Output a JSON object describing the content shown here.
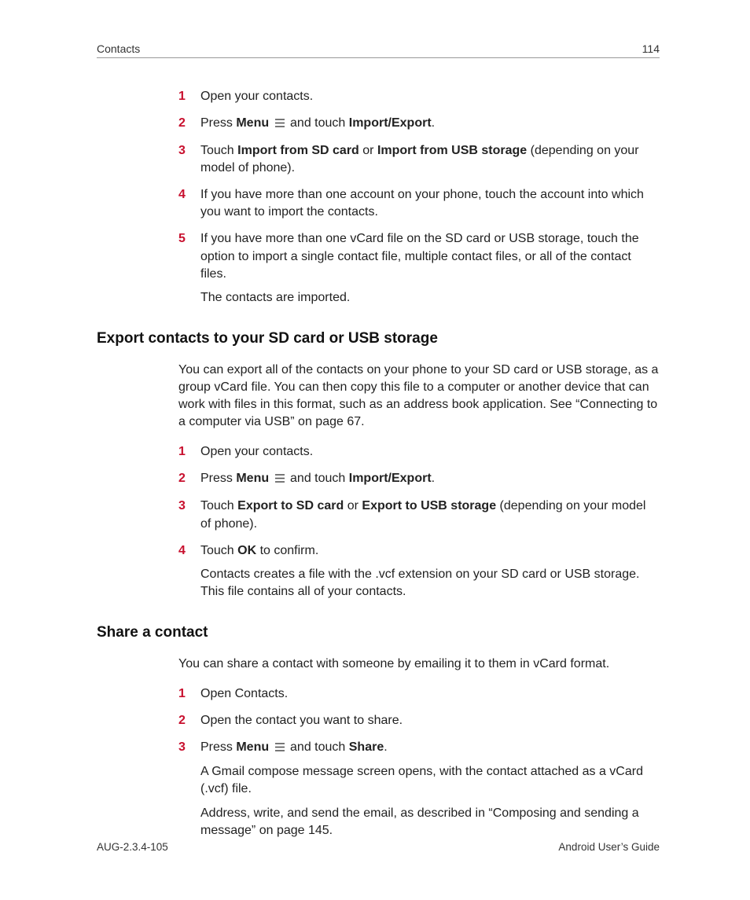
{
  "header": {
    "section": "Contacts",
    "page_number": "114"
  },
  "menu_label": "Menu",
  "import_section": {
    "steps": [
      {
        "n": "1",
        "body": [
          {
            "t": "Open your contacts."
          }
        ]
      },
      {
        "n": "2",
        "body": [
          {
            "t": "Press "
          },
          {
            "b": true,
            "t": "Menu"
          },
          {
            "t": " "
          },
          {
            "icon": true
          },
          {
            "t": " and touch "
          },
          {
            "b": true,
            "t": "Import/Export"
          },
          {
            "t": "."
          }
        ]
      },
      {
        "n": "3",
        "body": [
          {
            "t": "Touch "
          },
          {
            "b": true,
            "t": "Import from SD card"
          },
          {
            "t": " or "
          },
          {
            "b": true,
            "t": "Import from USB storage"
          },
          {
            "t": " (depending on your model of phone)."
          }
        ]
      },
      {
        "n": "4",
        "body": [
          {
            "t": "If you have more than one account on your phone, touch the account into which you want to import the contacts."
          }
        ]
      },
      {
        "n": "5",
        "body": [
          {
            "t": "If you have more than one vCard file on the SD card or USB storage, touch the option to import a single contact file, multiple contact files, or all of the contact files."
          }
        ],
        "extra": [
          {
            "t": "The contacts are imported."
          }
        ]
      }
    ]
  },
  "export_section": {
    "title": "Export contacts to your SD card or USB storage",
    "intro": "You can export all of the contacts on your phone to your SD card or USB storage, as a group vCard file. You can then copy this file to a computer or another device that can work with files in this format, such as an address book application. See “Connecting to a computer via USB” on page 67.",
    "steps": [
      {
        "n": "1",
        "body": [
          {
            "t": "Open your contacts."
          }
        ]
      },
      {
        "n": "2",
        "body": [
          {
            "t": "Press "
          },
          {
            "b": true,
            "t": "Menu"
          },
          {
            "t": " "
          },
          {
            "icon": true
          },
          {
            "t": " and touch "
          },
          {
            "b": true,
            "t": "Import/Export"
          },
          {
            "t": "."
          }
        ]
      },
      {
        "n": "3",
        "body": [
          {
            "t": "Touch "
          },
          {
            "b": true,
            "t": "Export to SD card"
          },
          {
            "t": " or "
          },
          {
            "b": true,
            "t": "Export to USB storage"
          },
          {
            "t": " (depending on your model of phone)."
          }
        ]
      },
      {
        "n": "4",
        "body": [
          {
            "t": "Touch "
          },
          {
            "b": true,
            "t": "OK"
          },
          {
            "t": " to confirm."
          }
        ],
        "extra": [
          {
            "t": "Contacts creates a file with the .vcf extension on your SD card or USB storage. This file contains all of your contacts."
          }
        ]
      }
    ]
  },
  "share_section": {
    "title": "Share a contact",
    "intro": "You can share a contact with someone by emailing it to them in vCard format.",
    "steps": [
      {
        "n": "1",
        "body": [
          {
            "t": "Open Contacts."
          }
        ]
      },
      {
        "n": "2",
        "body": [
          {
            "t": "Open the contact you want to share."
          }
        ]
      },
      {
        "n": "3",
        "body": [
          {
            "t": "Press "
          },
          {
            "b": true,
            "t": "Menu"
          },
          {
            "t": " "
          },
          {
            "icon": true
          },
          {
            "t": " and touch "
          },
          {
            "b": true,
            "t": "Share"
          },
          {
            "t": "."
          }
        ],
        "extra": [
          {
            "t": "A Gmail compose message screen opens, with the contact attached as a vCard (.vcf) file."
          }
        ],
        "extra2": [
          {
            "t": "Address, write, and send the email, as described in “Composing and sending a message” on page 145."
          }
        ]
      }
    ]
  },
  "footer": {
    "left": "AUG-2.3.4-105",
    "right": "Android User’s Guide"
  }
}
